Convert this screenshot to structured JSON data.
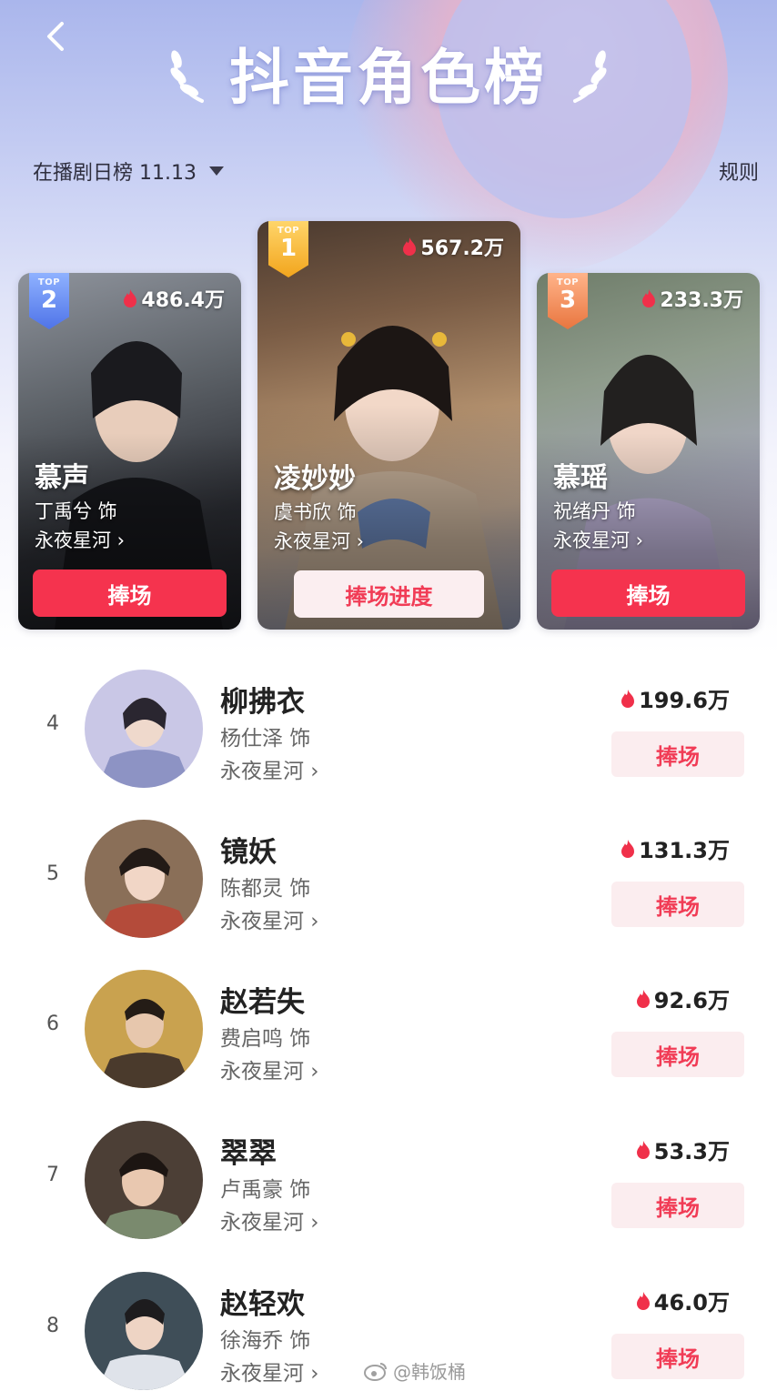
{
  "header": {
    "title": "抖音角色榜",
    "date_selector_label": "在播剧日榜 11.13",
    "rules_label": "规则"
  },
  "top3": [
    {
      "rank_label": "TOP",
      "rank": "2",
      "heat": "486.4万",
      "name": "慕声",
      "actor": "丁禹兮 饰",
      "drama": "永夜星河 ›",
      "button": "捧场"
    },
    {
      "rank_label": "TOP",
      "rank": "1",
      "heat": "567.2万",
      "name": "凌妙妙",
      "actor": "虞书欣 饰",
      "drama": "永夜星河 ›",
      "button": "捧场进度"
    },
    {
      "rank_label": "TOP",
      "rank": "3",
      "heat": "233.3万",
      "name": "慕瑶",
      "actor": "祝绪丹 饰",
      "drama": "永夜星河 ›",
      "button": "捧场"
    }
  ],
  "list": [
    {
      "rank": "4",
      "name": "柳拂衣",
      "actor": "杨仕泽 饰",
      "drama": "永夜星河 ›",
      "heat": "199.6万",
      "button": "捧场"
    },
    {
      "rank": "5",
      "name": "镜妖",
      "actor": "陈都灵 饰",
      "drama": "永夜星河 ›",
      "heat": "131.3万",
      "button": "捧场"
    },
    {
      "rank": "6",
      "name": "赵若失",
      "actor": "费启鸣 饰",
      "drama": "永夜星河 ›",
      "heat": "92.6万",
      "button": "捧场"
    },
    {
      "rank": "7",
      "name": "翠翠",
      "actor": "卢禹豪 饰",
      "drama": "永夜星河 ›",
      "heat": "53.3万",
      "button": "捧场"
    },
    {
      "rank": "8",
      "name": "赵轻欢",
      "actor": "徐海乔 饰",
      "drama": "永夜星河 ›",
      "heat": "46.0万",
      "button": "捧场"
    }
  ],
  "watermark": "@韩饭桶",
  "colors": {
    "accent_red": "#f5334e",
    "flame_red": "#f0304a",
    "badge_gold": "#f2a51d",
    "badge_blue": "#4f74e8",
    "badge_orange": "#e9763f"
  },
  "icons": {
    "back": "chevron-left-icon",
    "laurel": "laurel-icon",
    "heat": "flame-icon",
    "dropdown": "caret-down-icon",
    "watermark": "weibo-icon"
  }
}
